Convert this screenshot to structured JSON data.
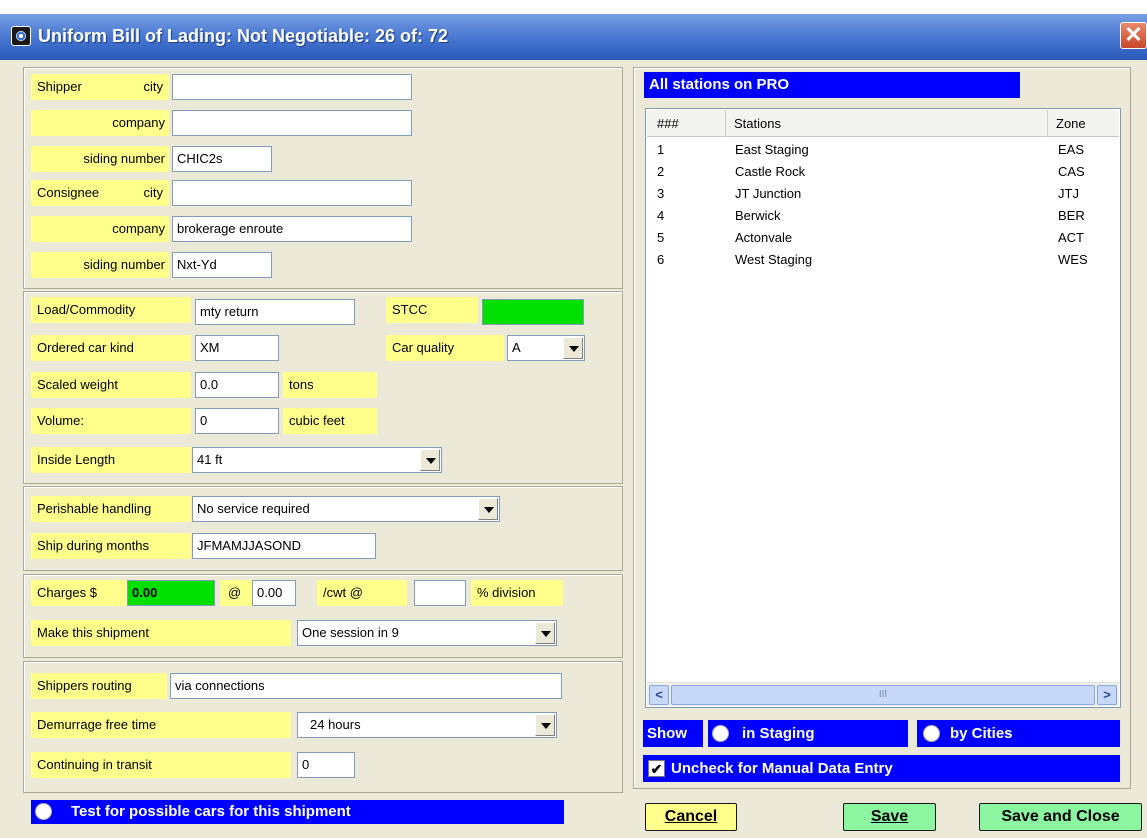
{
  "window": {
    "title": "Uniform Bill of Lading: Not Negotiable: 26 of: 72",
    "close_glyph": "✕"
  },
  "colors": {
    "label_bg": "#ffff8c",
    "blue_bar": "#0000ff",
    "green_field": "#00e000",
    "button_green": "#8cf5a0"
  },
  "shipper": {
    "label_shipper": "Shipper",
    "label_city": "city",
    "city_value": "",
    "label_company": "company",
    "company_value": "",
    "label_siding": "siding number",
    "siding_value": "CHIC2s"
  },
  "consignee": {
    "label_consignee": "Consignee",
    "label_city": "city",
    "city_value": "",
    "label_company": "company",
    "company_value": "brokerage enroute",
    "label_siding": "siding number",
    "siding_value": "Nxt-Yd"
  },
  "load": {
    "commodity_label": "Load/Commodity",
    "commodity_value": "mty return",
    "stcc_label": "STCC",
    "stcc_value": "",
    "car_kind_label": "Ordered car kind",
    "car_kind_value": "XM",
    "car_quality_label": "Car quality",
    "car_quality_value": "A",
    "weight_label": "Scaled weight",
    "weight_value": "0.0",
    "weight_unit": "tons",
    "volume_label": "Volume:",
    "volume_value": "0",
    "volume_unit": "cubic feet",
    "length_label": "Inside Length",
    "length_value": "41 ft"
  },
  "perishable": {
    "handling_label": "Perishable handling",
    "handling_value": "No service required",
    "months_label": "Ship during months",
    "months_value": "JFMAMJJASOND"
  },
  "charges": {
    "label": "Charges $",
    "value": "0.00",
    "at_label": "@",
    "rate_value": "0.00",
    "cwt_label": "/cwt @",
    "division_value": "",
    "division_label": "% division",
    "make_label": "Make this shipment",
    "make_value": "One session in 9"
  },
  "routing": {
    "shippers_label": "Shippers routing",
    "shippers_value": "via connections",
    "demurrage_label": "Demurrage free time",
    "demurrage_value": "24 hours",
    "transit_label": "Continuing in transit",
    "transit_value": "0"
  },
  "test_cars_label": "Test for possible cars for this shipment",
  "stations": {
    "header": "All stations on PRO",
    "columns": [
      "###",
      "Stations",
      "Zone"
    ],
    "rows": [
      {
        "num": "1",
        "name": "East Staging",
        "zone": "EAS"
      },
      {
        "num": "2",
        "name": "Castle Rock",
        "zone": "CAS"
      },
      {
        "num": "3",
        "name": "JT Junction",
        "zone": "JTJ"
      },
      {
        "num": "4",
        "name": "Berwick",
        "zone": "BER"
      },
      {
        "num": "5",
        "name": "Actonvale",
        "zone": "ACT"
      },
      {
        "num": "6",
        "name": "West Staging",
        "zone": "WES"
      }
    ],
    "scroll_thumb": "III"
  },
  "show": {
    "label": "Show",
    "staging_label": "in Staging",
    "cities_label": "by Cities"
  },
  "manual_entry": {
    "label": "Uncheck for Manual Data Entry",
    "checked": true,
    "check_glyph": "✔"
  },
  "buttons": {
    "cancel": "Cancel",
    "save": "Save",
    "save_close": "Save and Close"
  }
}
